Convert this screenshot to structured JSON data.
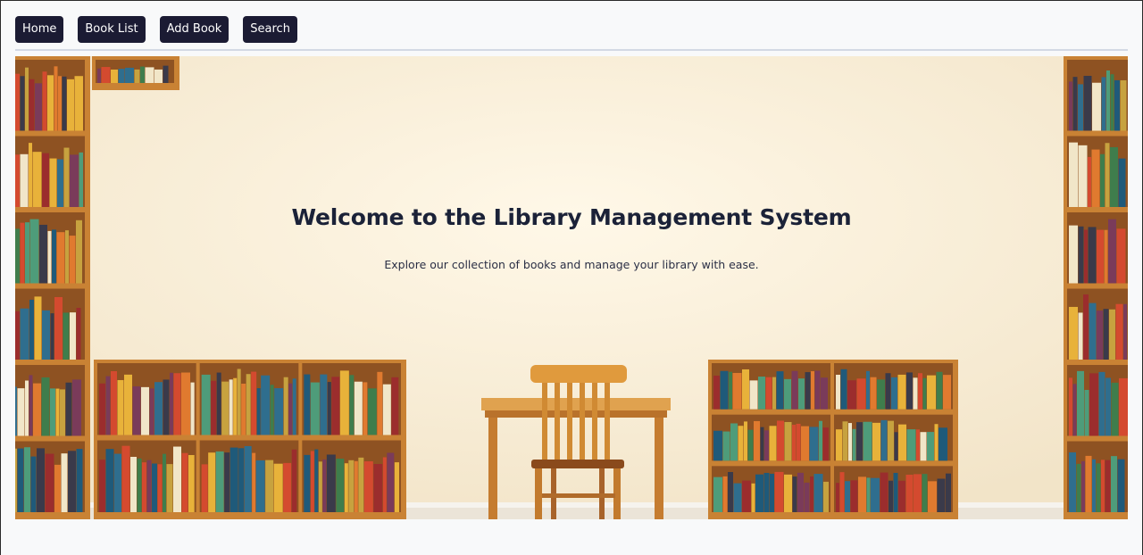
{
  "nav": {
    "items": [
      {
        "label": "Home"
      },
      {
        "label": "Book List"
      },
      {
        "label": "Add Book"
      },
      {
        "label": "Search"
      }
    ]
  },
  "hero": {
    "title": "Welcome to the Library Management System",
    "subtitle": "Explore our collection of books and manage your library with ease.",
    "image": "library-room-with-bookshelves-table-and-chair"
  },
  "colors": {
    "nav_button_bg": "#1b1b33",
    "nav_button_text": "#ffffff",
    "title_text": "#1b2238",
    "wall": "#fbf1de",
    "wood": "#cf8a3a"
  }
}
